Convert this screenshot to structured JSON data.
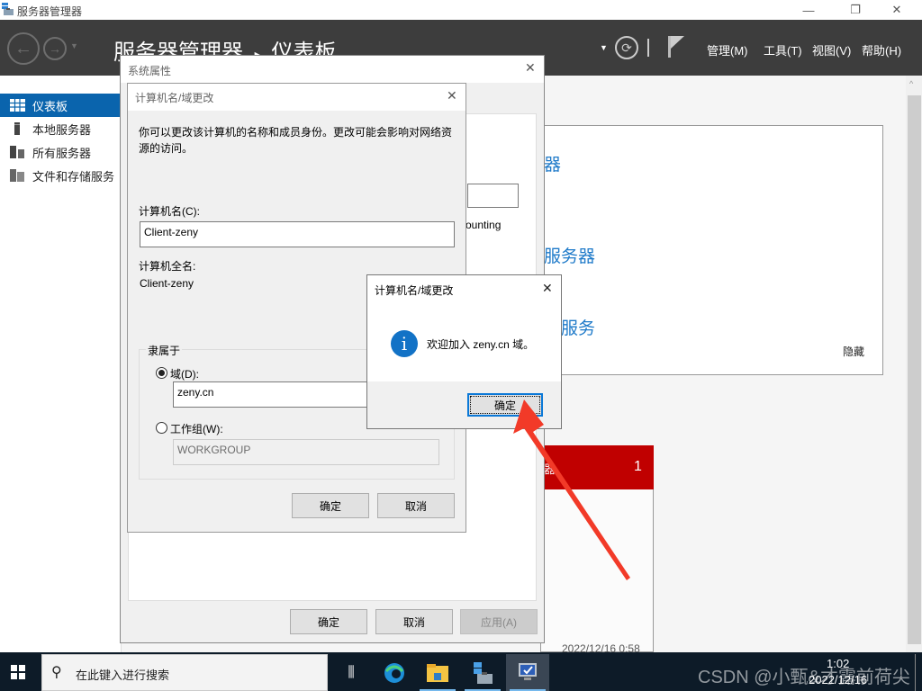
{
  "window": {
    "title": "服务器管理器",
    "controls": {
      "minimize": "—",
      "restore": "❐",
      "close": "✕"
    }
  },
  "header": {
    "breadcrumb_root": "服务器管理器",
    "breadcrumb_sep": "▸",
    "breadcrumb_current": "仪表板",
    "menus": [
      "管理(M)",
      "工具(T)",
      "视图(V)",
      "帮助(H)"
    ],
    "icons": [
      "back-icon",
      "forward-icon",
      "refresh-icon",
      "flag-icon"
    ]
  },
  "sidebar": {
    "items": [
      {
        "label": "仪表板",
        "icon": "dashboard-icon",
        "active": true
      },
      {
        "label": "本地服务器",
        "icon": "server-icon",
        "active": false
      },
      {
        "label": "所有服务器",
        "icon": "servers-icon",
        "active": false
      },
      {
        "label": "文件和存储服务",
        "icon": "storage-icon",
        "active": false
      }
    ]
  },
  "dashboard": {
    "welcome_links": [
      "器",
      "服务器",
      "服务"
    ],
    "hide_label": "隐藏",
    "partial_text": "ounting",
    "tile": {
      "title": "器",
      "count": "1",
      "timestamp": "2022/12/16 0:58"
    },
    "accent_color": "#c00000"
  },
  "system_properties": {
    "title": "系统属性",
    "buttons": {
      "ok": "确定",
      "cancel": "取消",
      "apply": "应用(A)"
    }
  },
  "computer_name_dialog": {
    "title": "计算机名/域更改",
    "description": "你可以更改该计算机的名称和成员身份。更改可能会影响对网络资源的访问。",
    "computer_name_label": "计算机名(C):",
    "computer_name_value": "Client-zeny",
    "full_name_label": "计算机全名:",
    "full_name_value": "Client-zeny",
    "member_of_label": "隶属于",
    "domain_label": "域(D):",
    "domain_value": "zeny.cn",
    "domain_selected": true,
    "workgroup_label": "工作组(W):",
    "workgroup_value": "WORKGROUP",
    "buttons": {
      "ok": "确定",
      "cancel": "取消"
    }
  },
  "message_box": {
    "title": "计算机名/域更改",
    "message": "欢迎加入 zeny.cn 域。",
    "ok": "确定",
    "icon": "info-icon"
  },
  "taskbar": {
    "search_placeholder": "在此键入进行搜索",
    "apps": [
      "task-view-icon",
      "edge-icon",
      "file-explorer-icon",
      "server-manager-icon",
      "system-properties-icon"
    ],
    "clock_time": "1:02",
    "clock_date": "2022/12/16",
    "watermark": "CSDN @小甄&才露前荷尖"
  }
}
